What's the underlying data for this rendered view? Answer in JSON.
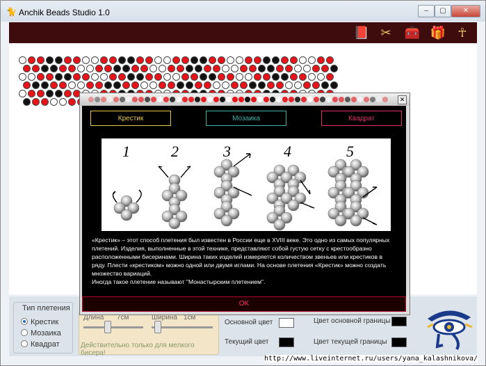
{
  "window": {
    "title": "Anchik Beads Studio 1.0",
    "min": "–",
    "max": "▢",
    "close": "✕"
  },
  "toolbar": {
    "icons": [
      "book-icon",
      "tools-icon",
      "chest-icon",
      "box-icon",
      "ankh-icon"
    ]
  },
  "canvas": {
    "rows": [
      "wrrbbrrwwrrbbrrwwrrbbrrwwrrbbrrwwrr",
      "rrbbrrwwrrbbrrwwrrbbrrwwrrbbrrwwrrb",
      "wwrrbbrrwwrrbbrrwwrrbbrrwwrrbbrrwwr",
      "rbbrrwwrrbbrrwwrrbbrrwwrrbbrrwwrrbb",
      "wrrbbrrwwrrbbrrwwrrbbrrwwrrbbrrwwrr",
      "brrwwrrbbrrwwrrbbrrwwrrbbrrwwrrbbrr"
    ],
    "colors": {
      "r": "#e8141a",
      "b": "#111111",
      "w": "#ffffff"
    }
  },
  "weave": {
    "label": "Тип плетения",
    "options": [
      {
        "label": "Крестик",
        "selected": true
      },
      {
        "label": "Мозаика",
        "selected": false
      },
      {
        "label": "Квадрат",
        "selected": false
      }
    ]
  },
  "size": {
    "length_label": "Длина",
    "length_value": "7см",
    "width_label": "Ширина",
    "width_value": "1см",
    "note": "Действительно только для мелкого бисера!"
  },
  "colors": {
    "main_label": "Основной цвет",
    "main_color": "#ffffff",
    "current_label": "Текущий цвет",
    "current_color": "#000000",
    "border_main_label": "Цвет основной границы",
    "border_main_color": "#000000",
    "border_current_label": "Цвет текущей границы",
    "border_current_color": "#000000"
  },
  "watermark_url": "http://www.liveinternet.ru/users/yana_kalashnikova/",
  "dialog": {
    "close": "✕",
    "tabs": [
      {
        "label": "Крестик",
        "color": "#e8c94a"
      },
      {
        "label": "Мозаика",
        "color": "#3cb4a8"
      },
      {
        "label": "Квадрат",
        "color": "#e0306a"
      }
    ],
    "steps": [
      "1",
      "2",
      "3",
      "4",
      "5"
    ],
    "description": "«Крестик» – этот способ плетения был известен в России еще в XVIII веке.  Это одно из самых популярных плетений. Изделия, выполненные в этой технике, представляют собой густую сетку с крестообразно расположенными бисеринами. Ширина таких изделий измеряется количеством звеньев или крестиков в ряду. Плести «крестиком» можно одной или двумя иглами. На основе плетения «Крестик» можно создать множество вариаций.\nИногда такое плетение называют \"Монастырским плетением\".",
    "ok": "OK"
  }
}
